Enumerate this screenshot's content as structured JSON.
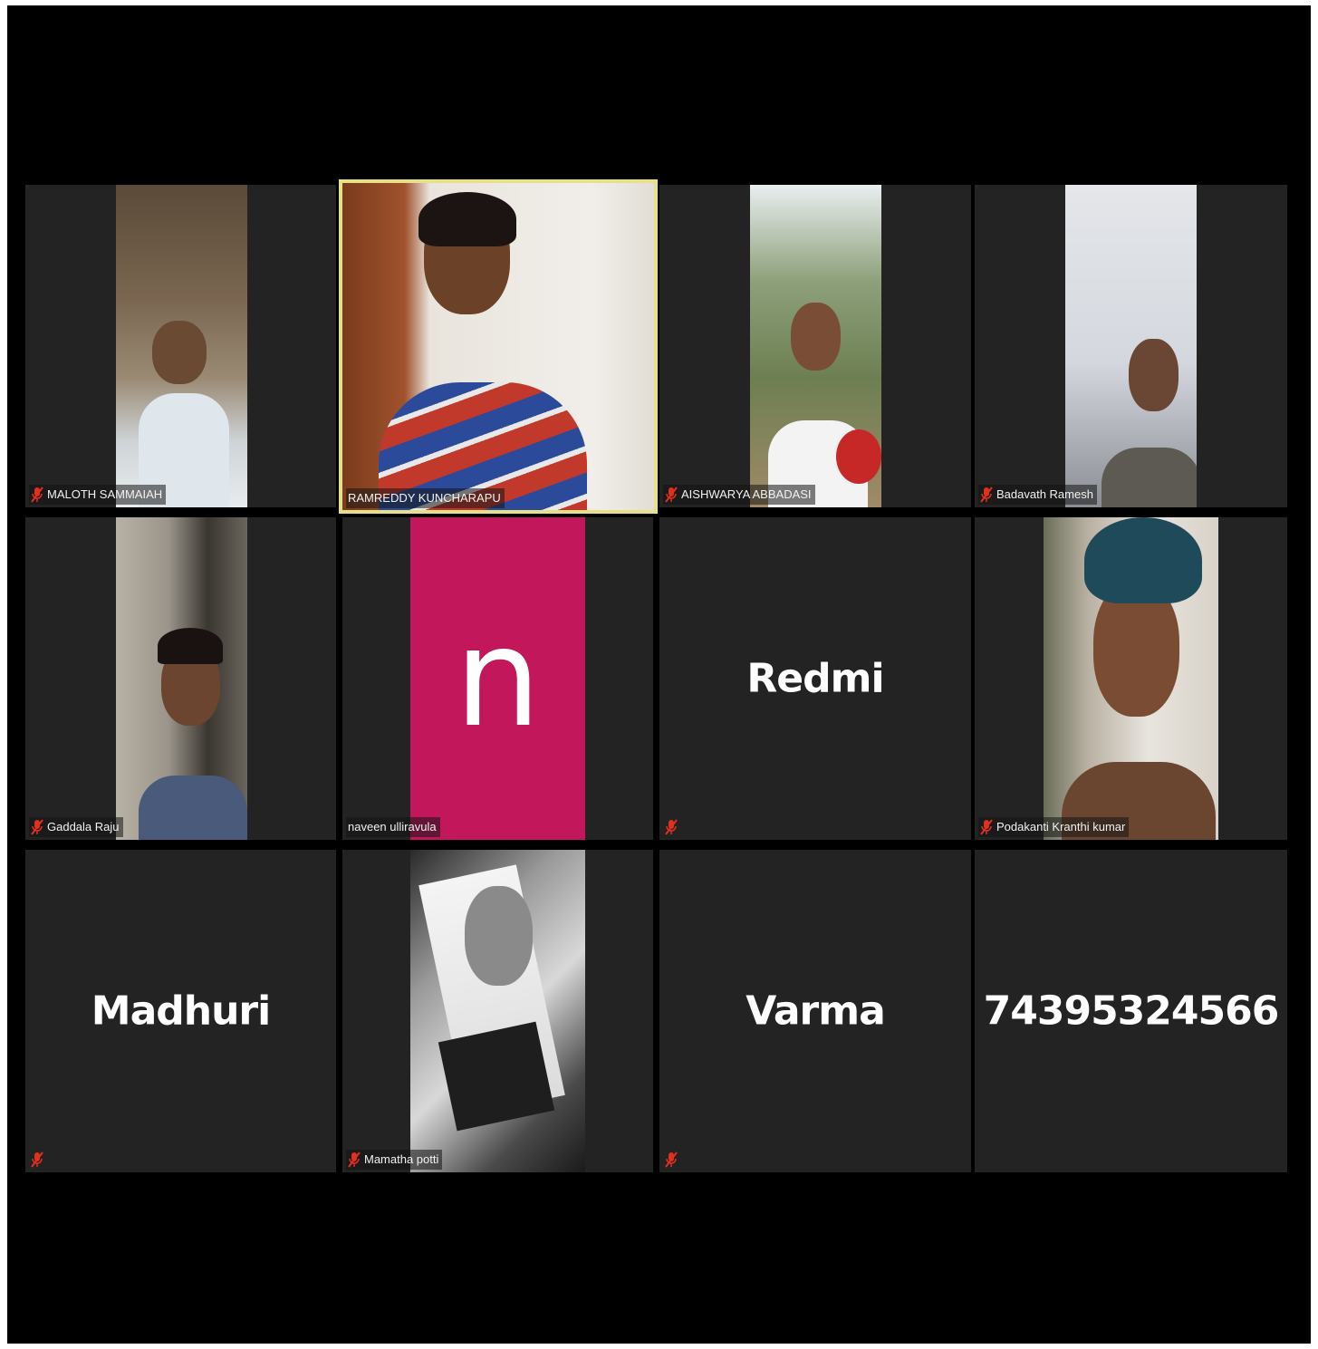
{
  "participants": [
    {
      "name": "MALOTH SAMMAIAH",
      "muted": true
    },
    {
      "name": "RAMREDDY KUNCHARAPU",
      "muted": false,
      "active_speaker": true
    },
    {
      "name": "AISHWARYA ABBADASI",
      "muted": true
    },
    {
      "name": "Badavath Ramesh",
      "muted": true
    },
    {
      "name": "Gaddala Raju",
      "muted": true
    },
    {
      "name": "naveen ulliravula",
      "muted": false,
      "avatar_letter": "n",
      "avatar_color": "#c2185b"
    },
    {
      "name": "",
      "display_name": "Redmi",
      "muted": true
    },
    {
      "name": "Podakanti Kranthi kumar",
      "muted": true
    },
    {
      "name": "",
      "display_name": "Madhuri",
      "muted": true
    },
    {
      "name": "Mamatha potti",
      "muted": true
    },
    {
      "name": "",
      "display_name": "Varma",
      "muted": true
    },
    {
      "name": "",
      "display_name": "74395324566",
      "muted": false
    }
  ],
  "colors": {
    "background": "#000000",
    "tile": "#232323",
    "active_border": "#e6e08a",
    "muted_icon": "#e0301e"
  },
  "icons": {
    "mute": "microphone-muted-icon"
  }
}
